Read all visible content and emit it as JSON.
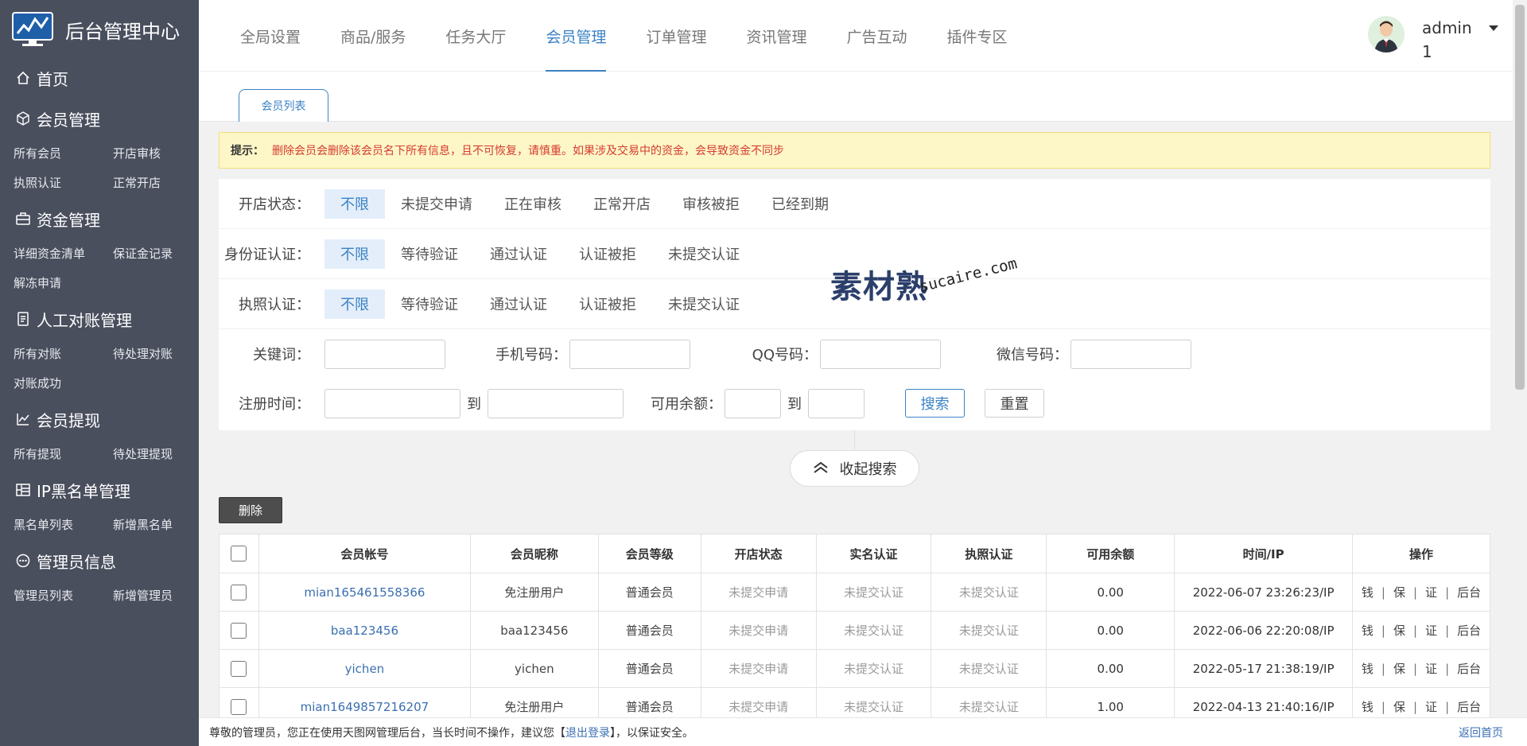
{
  "colors": {
    "sidebar_bg": "#4a4f5e",
    "accent": "#3b82c4",
    "notice_bg": "#fdf7c8",
    "notice_text": "#d53b2f"
  },
  "brand": {
    "title": "后台管理中心",
    "logo_icon": "monitor-chart-icon"
  },
  "sidebar": {
    "home": "首页",
    "groups": [
      {
        "title": "会员管理",
        "icon": "cube-icon",
        "items": [
          "所有会员",
          "开店审核",
          "执照认证",
          "正常开店"
        ]
      },
      {
        "title": "资金管理",
        "icon": "briefcase-icon",
        "items": [
          "详细资金清单",
          "保证金记录",
          "解冻申请"
        ]
      },
      {
        "title": "人工对账管理",
        "icon": "document-icon",
        "items": [
          "所有对账",
          "待处理对账",
          "对账成功"
        ]
      },
      {
        "title": "会员提现",
        "icon": "line-chart-icon",
        "items": [
          "所有提现",
          "待处理提现"
        ]
      },
      {
        "title": "IP黑名单管理",
        "icon": "table-grid-icon",
        "items": [
          "黑名单列表",
          "新增黑名单"
        ]
      },
      {
        "title": "管理员信息",
        "icon": "dots-circle-icon",
        "items": [
          "管理员列表",
          "新增管理员"
        ]
      }
    ]
  },
  "topnav": {
    "items": [
      "全局设置",
      "商品/服务",
      "任务大厅",
      "会员管理",
      "订单管理",
      "资讯管理",
      "广告互动",
      "插件专区"
    ],
    "active_index": 3
  },
  "user": {
    "name": "admin 1"
  },
  "tab": {
    "label": "会员列表"
  },
  "notice": {
    "label": "提示：",
    "text": "删除会员会删除该会员名下所有信息，且不可恢复，请慎重。如果涉及交易中的资金，会导致资金不同步"
  },
  "filters": [
    {
      "label": "开店状态：",
      "options": [
        "不限",
        "未提交申请",
        "正在审核",
        "正常开店",
        "审核被拒",
        "已经到期"
      ]
    },
    {
      "label": "身份证认证：",
      "options": [
        "不限",
        "等待验证",
        "通过认证",
        "认证被拒",
        "未提交认证"
      ]
    },
    {
      "label": "执照认证：",
      "options": [
        "不限",
        "等待验证",
        "通过认证",
        "认证被拒",
        "未提交认证"
      ]
    }
  ],
  "search_form": {
    "keyword_label": "关键词：",
    "phone_label": "手机号码：",
    "qq_label": "QQ号码：",
    "wechat_label": "微信号码：",
    "regtime_label": "注册时间：",
    "balance_label": "可用余额：",
    "to": "到",
    "search_btn": "搜索",
    "reset_btn": "重置"
  },
  "collapse_label": "收起搜索",
  "delete_btn": "删除",
  "table": {
    "headers": [
      "会员帐号",
      "会员昵称",
      "会员等级",
      "开店状态",
      "实名认证",
      "执照认证",
      "可用余额",
      "时间/IP",
      "操作"
    ],
    "rows": [
      {
        "account": "mian165461558366",
        "nickname": "免注册用户",
        "level": "普通会员",
        "shop": "未提交申请",
        "realname": "未提交认证",
        "license": "未提交认证",
        "balance": "0.00",
        "time": "2022-06-07 23:26:23/IP"
      },
      {
        "account": "baa123456",
        "nickname": "baa123456",
        "level": "普通会员",
        "shop": "未提交申请",
        "realname": "未提交认证",
        "license": "未提交认证",
        "balance": "0.00",
        "time": "2022-06-06 22:20:08/IP"
      },
      {
        "account": "yichen",
        "nickname": "yichen",
        "level": "普通会员",
        "shop": "未提交申请",
        "realname": "未提交认证",
        "license": "未提交认证",
        "balance": "0.00",
        "time": "2022-05-17 21:38:19/IP"
      },
      {
        "account": "mian1649857216207",
        "nickname": "免注册用户",
        "level": "普通会员",
        "shop": "未提交申请",
        "realname": "未提交认证",
        "license": "未提交认证",
        "balance": "1.00",
        "time": "2022-04-13 21:40:16/IP"
      }
    ],
    "ops": [
      "钱",
      "保",
      "证",
      "后台"
    ]
  },
  "footer": {
    "text_before": "尊敬的管理员，您正在使用天图网管理后台，当长时间不操作，建议您【",
    "logout": "退出登录",
    "text_after": "】，以保证安全。",
    "home_link": "返回首页"
  },
  "watermark": {
    "cn": "素材熟",
    "en": "sucaire.com"
  }
}
